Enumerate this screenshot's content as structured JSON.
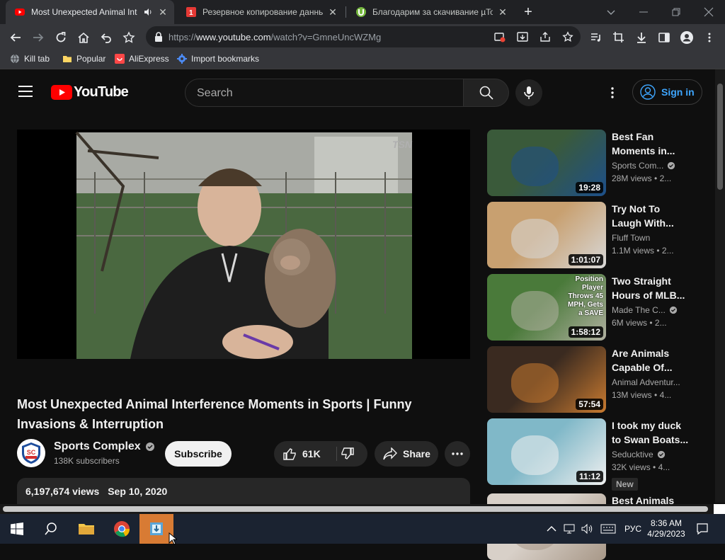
{
  "browser": {
    "tabs": [
      {
        "title": "Most Unexpected Animal Int",
        "active": true
      },
      {
        "title": "Резервное копирование данны",
        "active": false
      },
      {
        "title": "Благодарим за скачивание µTor",
        "active": false
      }
    ],
    "url_prefix": "https://",
    "url_host": "www.youtube.com",
    "url_path": "/watch?v=GmneUncWZMg",
    "bookmarks": [
      "Kill tab",
      "Popular",
      "AliExpress",
      "Import bookmarks"
    ]
  },
  "youtube": {
    "logo_text": "YouTube",
    "search_placeholder": "Search",
    "sign_in": "Sign in",
    "video": {
      "title": "Most Unexpected Animal Interference Moments in Sports | Funny Invasions & Interruption",
      "channel": "Sports Complex",
      "channel_avatar_text": "SC",
      "subscribers": "138K subscribers",
      "subscribe": "Subscribe",
      "likes": "61K",
      "share": "Share",
      "views": "6,197,674 views",
      "date": "Sep 10, 2020",
      "watermark": "TSN"
    },
    "recommendations": [
      {
        "title1": "Best Fan",
        "title2": "Moments in...",
        "channel": "Sports Com...",
        "verified": true,
        "views": "28M views",
        "age": "2...",
        "duration": "19:28",
        "colors": [
          "#3a5a3a",
          "#1d4f8a"
        ]
      },
      {
        "title1": "Try Not To",
        "title2": "Laugh With...",
        "channel": "Fluff Town",
        "verified": false,
        "views": "1.1M views",
        "age": "2...",
        "duration": "1:01:07",
        "colors": [
          "#c8a070",
          "#d8d8d8"
        ]
      },
      {
        "title1": "Two Straight",
        "title2": "Hours of MLB...",
        "channel": "Made The C...",
        "verified": true,
        "views": "6M views",
        "age": "2...",
        "duration": "1:58:12",
        "overlay": [
          "Position",
          "Player",
          "Throws 45",
          "MPH, Gets",
          "a SAVE"
        ],
        "colors": [
          "#4a7a3a",
          "#b0b0a0"
        ]
      },
      {
        "title1": "Are Animals",
        "title2": "Capable Of...",
        "channel": "Animal Adventur...",
        "verified": false,
        "views": "13M views",
        "age": "4...",
        "duration": "57:54",
        "colors": [
          "#3a2a20",
          "#c87a30"
        ]
      },
      {
        "title1": "I took my duck",
        "title2": "to Swan Boats...",
        "channel": "Seducktive",
        "verified": true,
        "views": "32K views",
        "age": "4...",
        "duration": "11:12",
        "badge": "New",
        "colors": [
          "#80b8c8",
          "#f0f0f0"
        ]
      },
      {
        "title1": "Best Animals",
        "title2": "",
        "channel": "",
        "verified": false,
        "views": "",
        "age": "",
        "duration": "",
        "colors": [
          "#d8d0c8",
          "#a89888"
        ]
      }
    ]
  },
  "taskbar": {
    "language": "РУС",
    "time": "8:36 AM",
    "date": "4/29/2023"
  },
  "colors": {
    "accent": "#3ea6ff",
    "youtube_red": "#ff0000"
  }
}
